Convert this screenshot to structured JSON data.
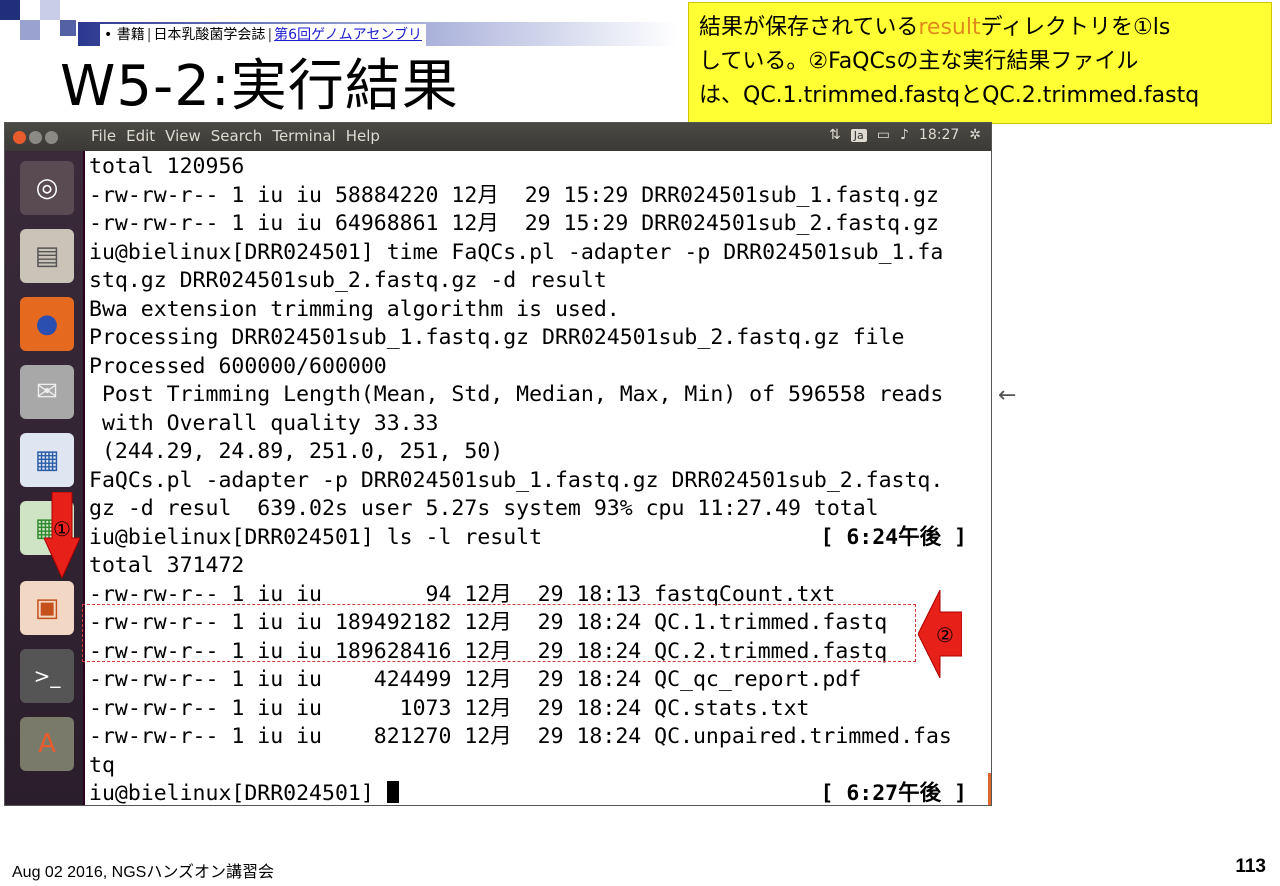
{
  "breadcrumb": {
    "item1": "書籍",
    "item2": "日本乳酸菌学会誌",
    "item3": "第6回ゲノムアセンブリ"
  },
  "slide_title": "W5-2:実行結果",
  "note": {
    "part1": "結果が保存されている",
    "highlight": "result",
    "part2": "ディレクトリを①ls",
    "line2": "している。②FaQCsの主な実行結果ファイル",
    "line3": "は、QC.1.trimmed.fastqとQC.2.trimmed.fastq"
  },
  "terminal": {
    "menu": [
      "File",
      "Edit",
      "View",
      "Search",
      "Terminal",
      "Help"
    ],
    "tray": {
      "input_method": "Ja",
      "clock": "18:27"
    },
    "lines": [
      "total 120956",
      "-rw-rw-r-- 1 iu iu 58884220 12月  29 15:29 DRR024501sub_1.fastq.gz",
      "-rw-rw-r-- 1 iu iu 64968861 12月  29 15:29 DRR024501sub_2.fastq.gz",
      "iu@bielinux[DRR024501] time FaQCs.pl -adapter -p DRR024501sub_1.fa",
      "stq.gz DRR024501sub_2.fastq.gz -d result",
      "Bwa extension trimming algorithm is used.",
      "Processing DRR024501sub_1.fastq.gz DRR024501sub_2.fastq.gz file",
      "Processed 600000/600000",
      " Post Trimming Length(Mean, Std, Median, Max, Min) of 596558 reads",
      " with Overall quality 33.33",
      " (244.29, 24.89, 251.0, 251, 50)",
      "FaQCs.pl -adapter -p DRR024501sub_1.fastq.gz DRR024501sub_2.fastq.",
      "gz -d resul  639.02s user 5.27s system 93% cpu 11:27.49 total",
      "iu@bielinux[DRR024501] ls -l result",
      "total 371472",
      "-rw-rw-r-- 1 iu iu        94 12月  29 18:13 fastqCount.txt",
      "-rw-rw-r-- 1 iu iu 189492182 12月  29 18:24 QC.1.trimmed.fastq",
      "-rw-rw-r-- 1 iu iu 189628416 12月  29 18:24 QC.2.trimmed.fastq",
      "-rw-rw-r-- 1 iu iu    424499 12月  29 18:24 QC_qc_report.pdf",
      "-rw-rw-r-- 1 iu iu      1073 12月  29 18:24 QC.stats.txt",
      "-rw-rw-r-- 1 iu iu    821270 12月  29 18:24 QC.unpaired.trimmed.fas",
      "tq",
      "iu@bielinux[DRR024501] "
    ],
    "right_prompt_1": "[ 6:24午後 ]",
    "right_prompt_2": "[ 6:27午後 ]"
  },
  "annotations": {
    "marker1": "①",
    "marker2": "②",
    "arrow": "←"
  },
  "footer": "Aug 02 2016, NGSハンズオン講習会",
  "page_number": "113",
  "colors": {
    "note_bg": "#ffff33",
    "highlight": "#e08a1c",
    "marker": "#e8201a"
  }
}
